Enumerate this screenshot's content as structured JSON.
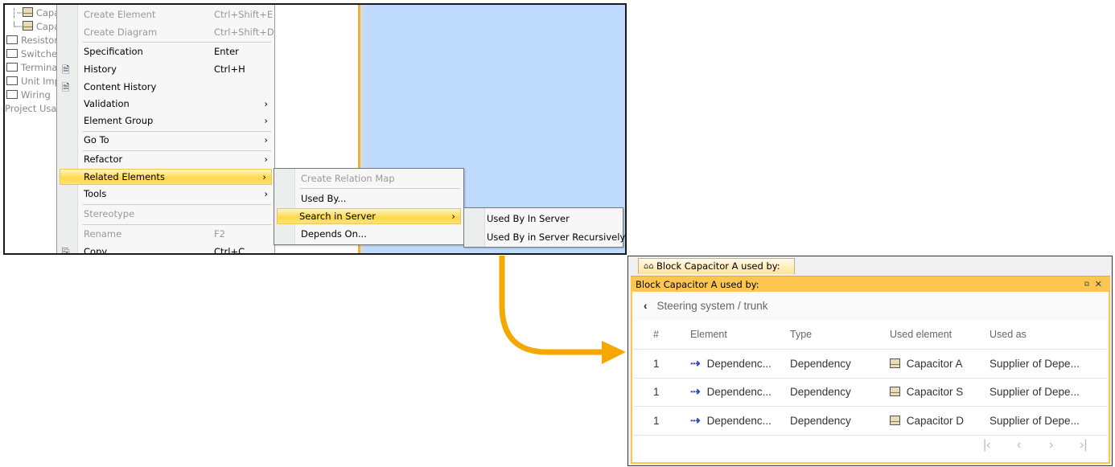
{
  "tree": {
    "items": [
      {
        "label": "Capacitor A",
        "icon": "block-icon"
      },
      {
        "label": "Capacitor S",
        "icon": "block-icon"
      },
      {
        "label": "Resistors",
        "icon": "folder-icon"
      },
      {
        "label": "Switches",
        "icon": "folder-icon"
      },
      {
        "label": "Terminals",
        "icon": "folder-icon"
      },
      {
        "label": "Unit Imp",
        "icon": "folder-icon"
      },
      {
        "label": "Wiring",
        "icon": "folder-icon"
      },
      {
        "label": "Project Usages"
      }
    ]
  },
  "context_menu": {
    "items": [
      {
        "label": "Create Element",
        "shortcut": "Ctrl+Shift+E",
        "disabled": true
      },
      {
        "label": "Create Diagram",
        "shortcut": "Ctrl+Shift+D",
        "disabled": true
      },
      {
        "label": "Specification",
        "shortcut": "Enter"
      },
      {
        "label": "History",
        "shortcut": "Ctrl+H",
        "icon": "history-icon"
      },
      {
        "label": "Content History",
        "icon": "history-icon"
      },
      {
        "label": "Validation",
        "submenu": true
      },
      {
        "label": "Element Group",
        "submenu": true
      },
      {
        "label": "Go To",
        "submenu": true
      },
      {
        "label": "Refactor",
        "submenu": true
      },
      {
        "label": "Related Elements",
        "submenu": true,
        "highlighted": true
      },
      {
        "label": "Tools",
        "submenu": true
      },
      {
        "label": "Stereotype",
        "disabled": true
      },
      {
        "label": "Rename",
        "shortcut": "F2",
        "disabled": true
      },
      {
        "label": "Copy",
        "shortcut": "Ctrl+C",
        "icon": "copy-icon"
      }
    ]
  },
  "related_submenu": {
    "items": [
      {
        "label": "Create Relation Map",
        "disabled": true
      },
      {
        "label": "Used By..."
      },
      {
        "label": "Search in Server",
        "submenu": true,
        "highlighted": true
      },
      {
        "label": "Depends On..."
      }
    ]
  },
  "server_submenu": {
    "items": [
      {
        "label": "Used By In Server"
      },
      {
        "label": "Used By in Server Recursively"
      }
    ]
  },
  "panel": {
    "tab_label": "Block Capacitor A used by:",
    "header_title": "Block Capacitor A used by:",
    "breadcrumb": "Steering system / trunk",
    "columns": [
      "#",
      "Element",
      "Type",
      "Used element",
      "Used as"
    ],
    "rows": [
      {
        "num": "1",
        "element": "Dependenc...",
        "type": "Dependency",
        "used_element": "Capacitor A",
        "used_as": "Supplier of Depe..."
      },
      {
        "num": "1",
        "element": "Dependenc...",
        "type": "Dependency",
        "used_element": "Capacitor S",
        "used_as": "Supplier of Depe..."
      },
      {
        "num": "1",
        "element": "Dependenc...",
        "type": "Dependency",
        "used_element": "Capacitor D",
        "used_as": "Supplier of Depe..."
      }
    ]
  },
  "colors": {
    "accent": "#FFC64F",
    "arrow": "#F5A800",
    "highlight": "#FFD84A",
    "canvas": "#BEDAFC"
  }
}
